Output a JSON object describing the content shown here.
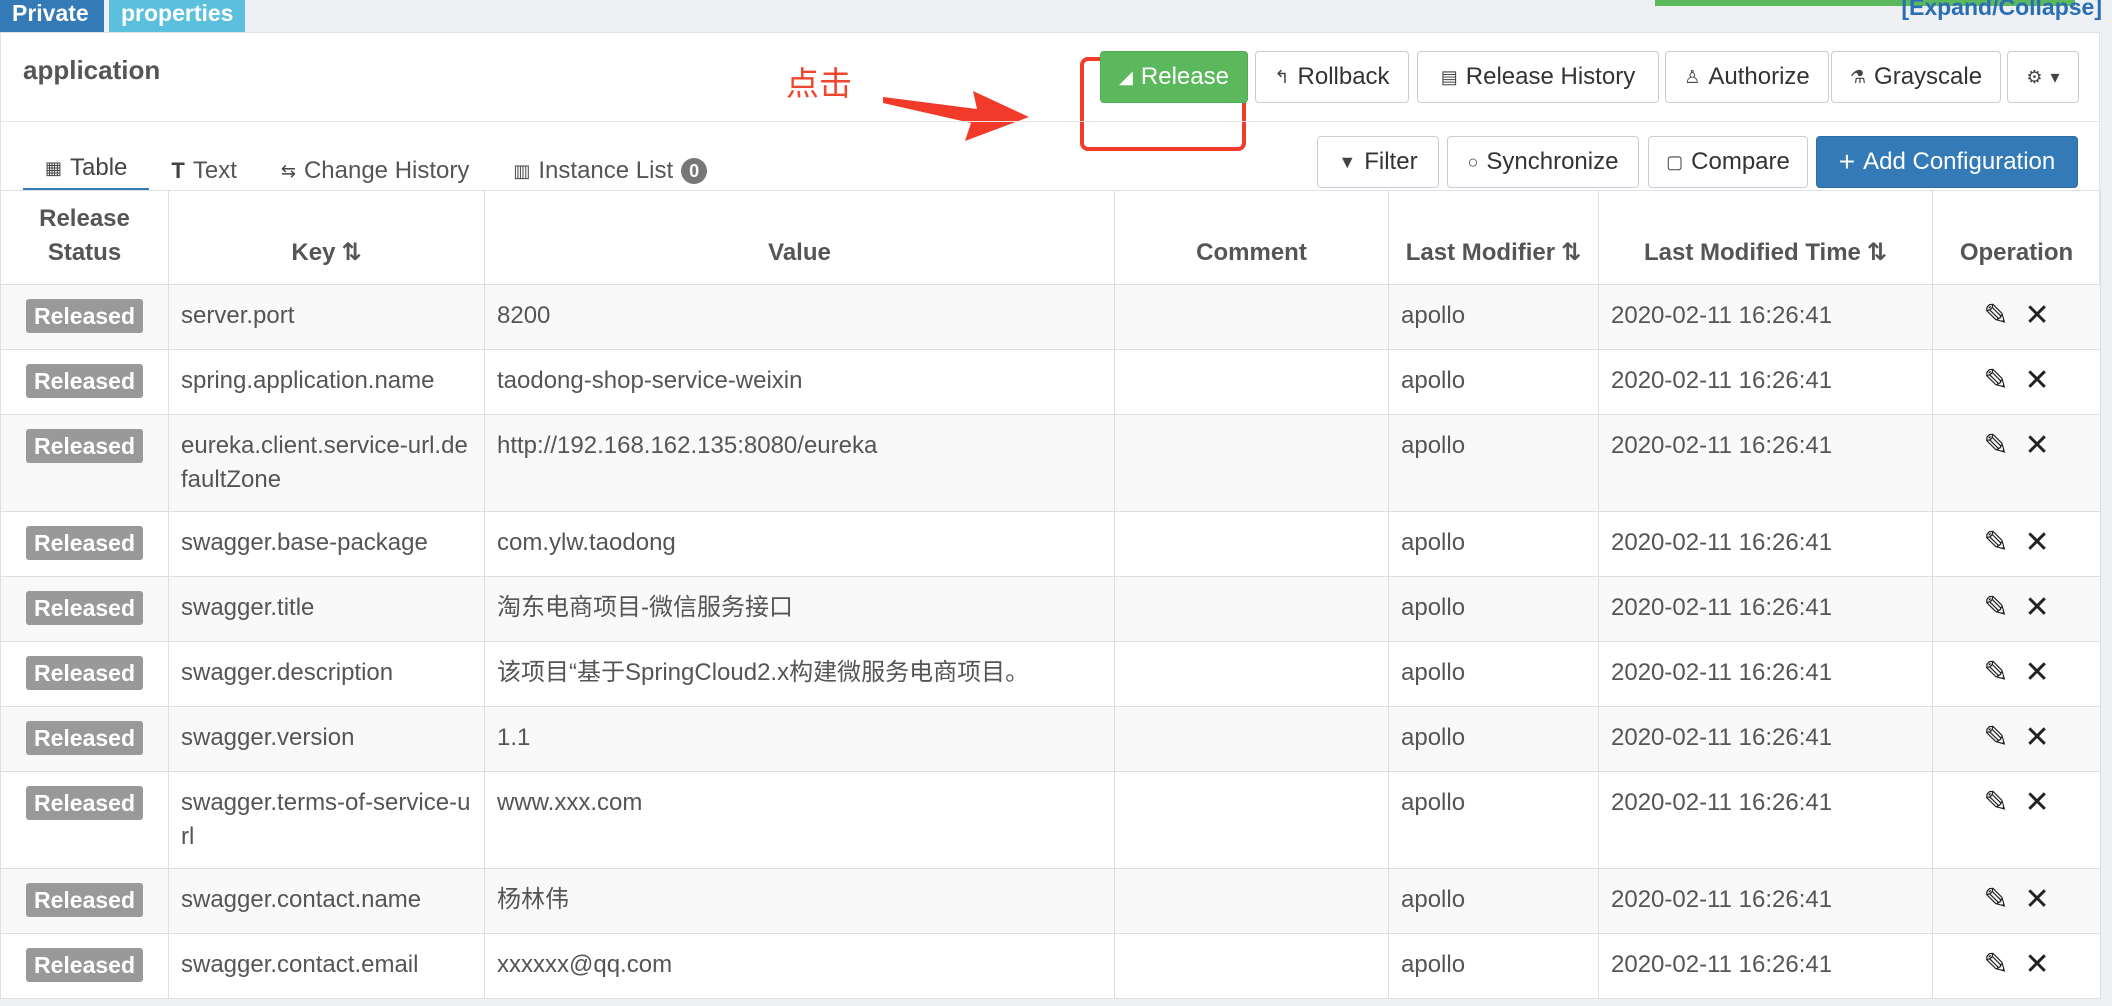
{
  "tags": {
    "private": "Private",
    "format": "properties"
  },
  "expand_collapse": "[Expand/Collapse]",
  "namespace": {
    "title": "application"
  },
  "annotation": {
    "label": "点击"
  },
  "toolbar": {
    "release": "Release",
    "rollback": "Rollback",
    "release_history": "Release History",
    "authorize": "Authorize",
    "grayscale": "Grayscale"
  },
  "tabs": {
    "table": "Table",
    "text": "Text",
    "change_history": "Change History",
    "instance_list": "Instance List",
    "instance_count": "0"
  },
  "actions": {
    "filter": "Filter",
    "synchronize": "Synchronize",
    "compare": "Compare",
    "add_configuration": "Add Configuration"
  },
  "table": {
    "headers": {
      "release_status": "Release Status",
      "key": "Key",
      "value": "Value",
      "comment": "Comment",
      "last_modifier": "Last Modifier",
      "last_modified_time": "Last Modified Time",
      "operation": "Operation"
    },
    "rows": [
      {
        "status": "Released",
        "key": "server.port",
        "value": "8200",
        "comment": "",
        "modifier": "apollo",
        "time": "2020-02-11 16:26:41"
      },
      {
        "status": "Released",
        "key": "spring.application.name",
        "value": "taodong-shop-service-weixin",
        "comment": "",
        "modifier": "apollo",
        "time": "2020-02-11 16:26:41"
      },
      {
        "status": "Released",
        "key": "eureka.client.service-url.defaultZone",
        "value": "http://192.168.162.135:8080/eureka",
        "comment": "",
        "modifier": "apollo",
        "time": "2020-02-11 16:26:41"
      },
      {
        "status": "Released",
        "key": "swagger.base-package",
        "value": "com.ylw.taodong",
        "comment": "",
        "modifier": "apollo",
        "time": "2020-02-11 16:26:41"
      },
      {
        "status": "Released",
        "key": "swagger.title",
        "value": "淘东电商项目-微信服务接口",
        "comment": "",
        "modifier": "apollo",
        "time": "2020-02-11 16:26:41"
      },
      {
        "status": "Released",
        "key": "swagger.description",
        "value": "该项目“基于SpringCloud2.x构建微服务电商项目。",
        "comment": "",
        "modifier": "apollo",
        "time": "2020-02-11 16:26:41"
      },
      {
        "status": "Released",
        "key": "swagger.version",
        "value": "1.1",
        "comment": "",
        "modifier": "apollo",
        "time": "2020-02-11 16:26:41"
      },
      {
        "status": "Released",
        "key": "swagger.terms-of-service-url",
        "value": "www.xxx.com",
        "comment": "",
        "modifier": "apollo",
        "time": "2020-02-11 16:26:41"
      },
      {
        "status": "Released",
        "key": "swagger.contact.name",
        "value": "杨林伟",
        "comment": "",
        "modifier": "apollo",
        "time": "2020-02-11 16:26:41"
      },
      {
        "status": "Released",
        "key": "swagger.contact.email",
        "value": "xxxxxx@qq.com",
        "comment": "",
        "modifier": "apollo",
        "time": "2020-02-11 16:26:41"
      }
    ]
  },
  "icons": {
    "release": "send-icon",
    "rollback": "rollback-icon",
    "history": "calendar-icon",
    "authorize": "user-icon",
    "grayscale": "flask-icon",
    "settings": "gear-icon",
    "edit": "edit-icon",
    "delete": "close-icon"
  },
  "colors": {
    "primary": "#337ab7",
    "success": "#5cb85c",
    "info": "#5bc0de",
    "annotation": "#f23a2b",
    "status_badge": "#999999"
  }
}
